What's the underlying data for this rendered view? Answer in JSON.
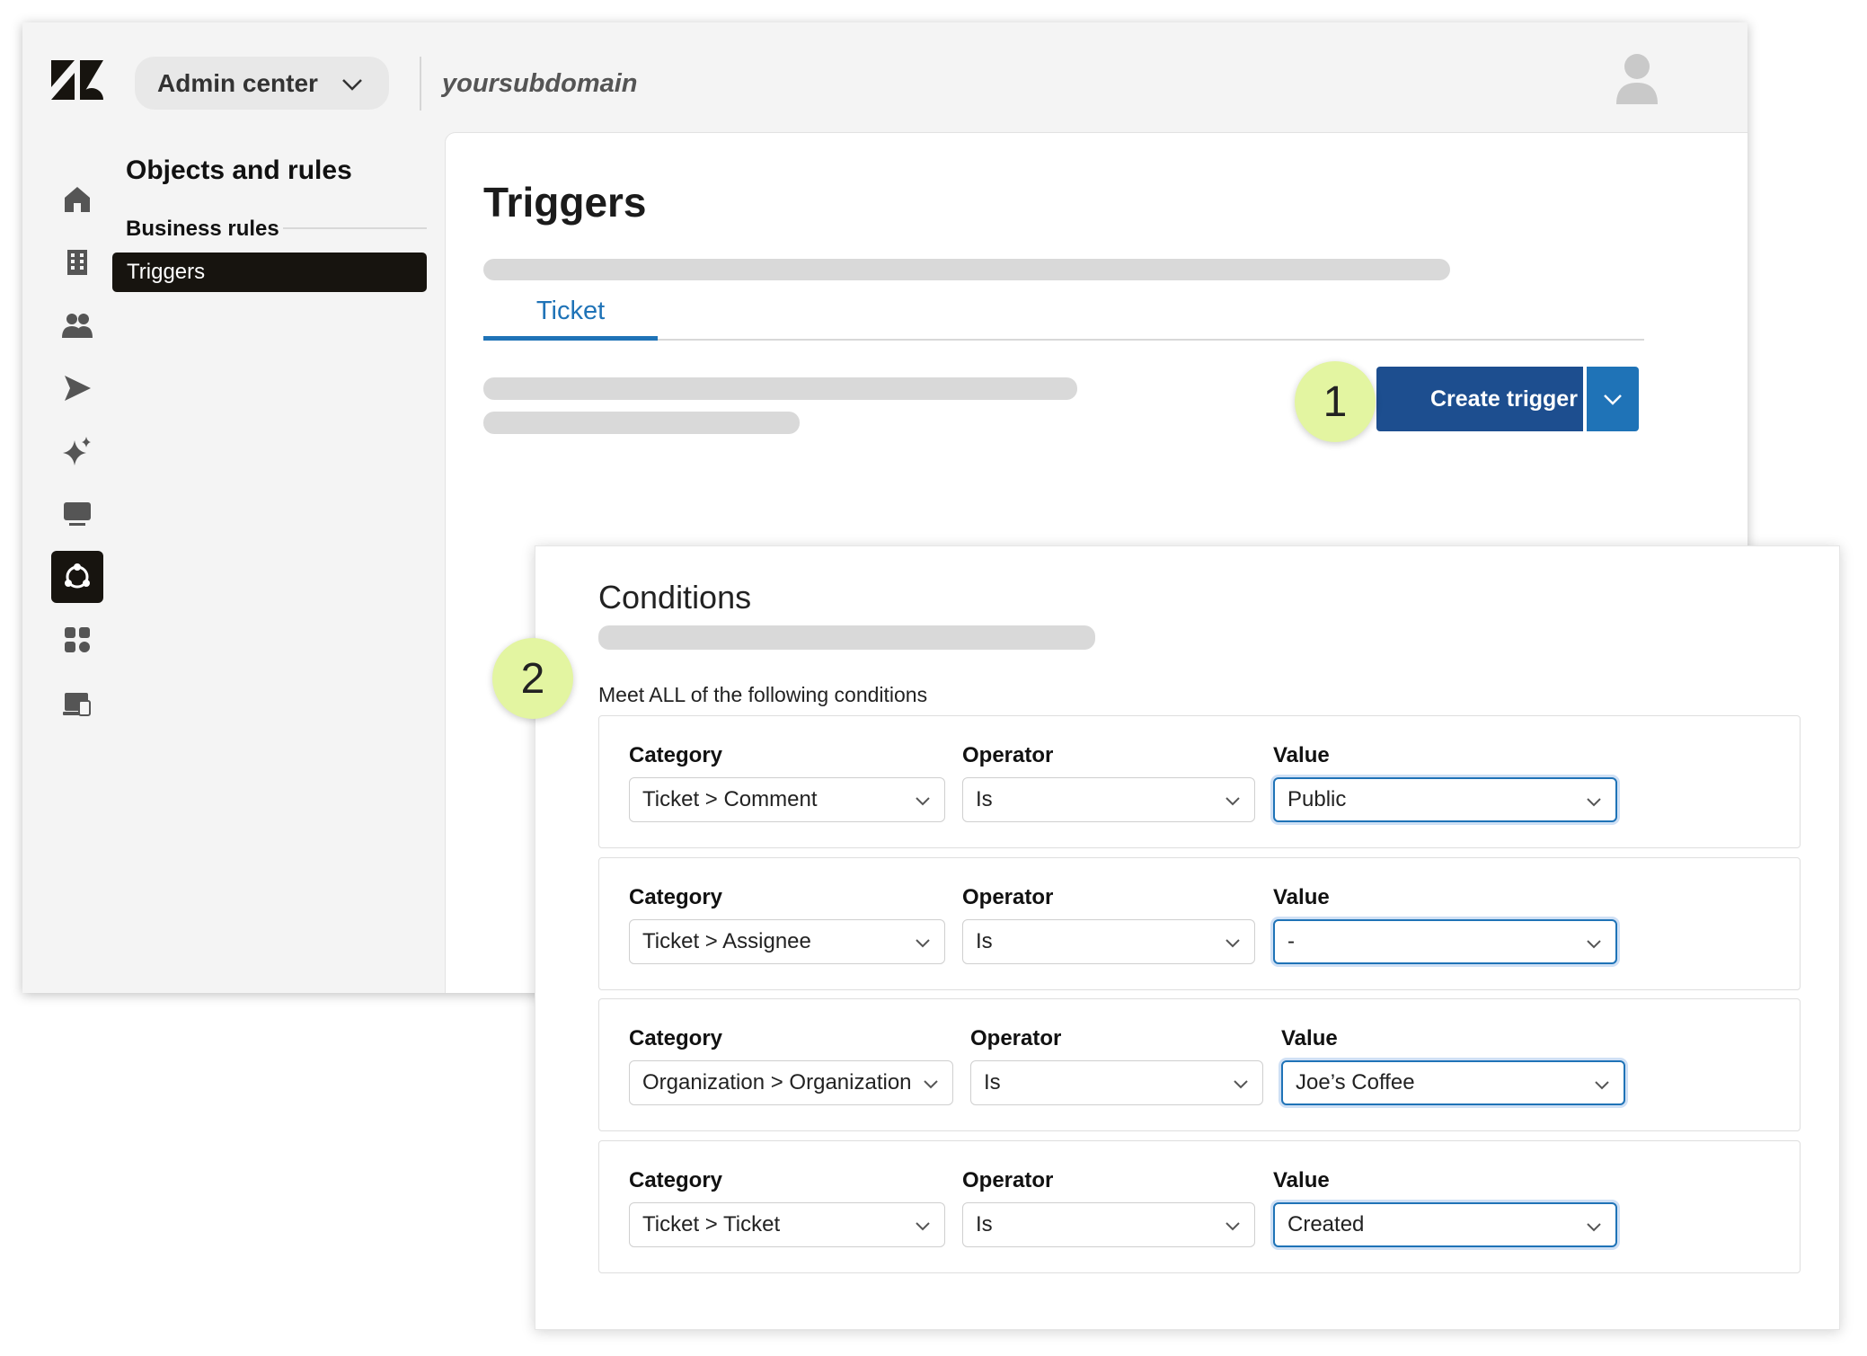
{
  "header": {
    "product_label": "Admin center",
    "subdomain": "yoursubdomain"
  },
  "rail": {
    "icons": [
      "home-icon",
      "building-icon",
      "people-icon",
      "send-icon",
      "sparkle-icon",
      "monitor-icon",
      "objects-rules-icon",
      "apps-icon",
      "workspace-icon"
    ],
    "active": "objects-rules-icon"
  },
  "nav": {
    "title": "Objects and rules",
    "section": "Business rules",
    "active_item": "Triggers"
  },
  "main": {
    "title": "Triggers",
    "tab": "Ticket",
    "create_button": "Create trigger"
  },
  "badges": {
    "one": "1",
    "two": "2"
  },
  "conditions": {
    "title": "Conditions",
    "subtitle": "Meet ALL of the following conditions",
    "rows": [
      {
        "category_label": "Category",
        "operator_label": "Operator",
        "value_label": "Value",
        "category": "Ticket > Comment",
        "operator": "Is",
        "value": "Public"
      },
      {
        "category_label": "Category",
        "operator_label": "Operator",
        "value_label": "Value",
        "category": "Ticket > Assignee",
        "operator": "Is",
        "value": "-"
      },
      {
        "category_label": "Category",
        "operator_label": "Operator",
        "value_label": "Value",
        "category": "Organization > Organization",
        "operator": "Is",
        "value": "Joe’s Coffee"
      },
      {
        "category_label": "Category",
        "operator_label": "Operator",
        "value_label": "Value",
        "category": "Ticket > Ticket",
        "operator": "Is",
        "value": "Created"
      }
    ]
  },
  "colors": {
    "accent_blue": "#1f73b7",
    "create_button_blue": "#1d4e8f",
    "badge_green": "#e3f5a1",
    "active_nav": "#17140f"
  }
}
